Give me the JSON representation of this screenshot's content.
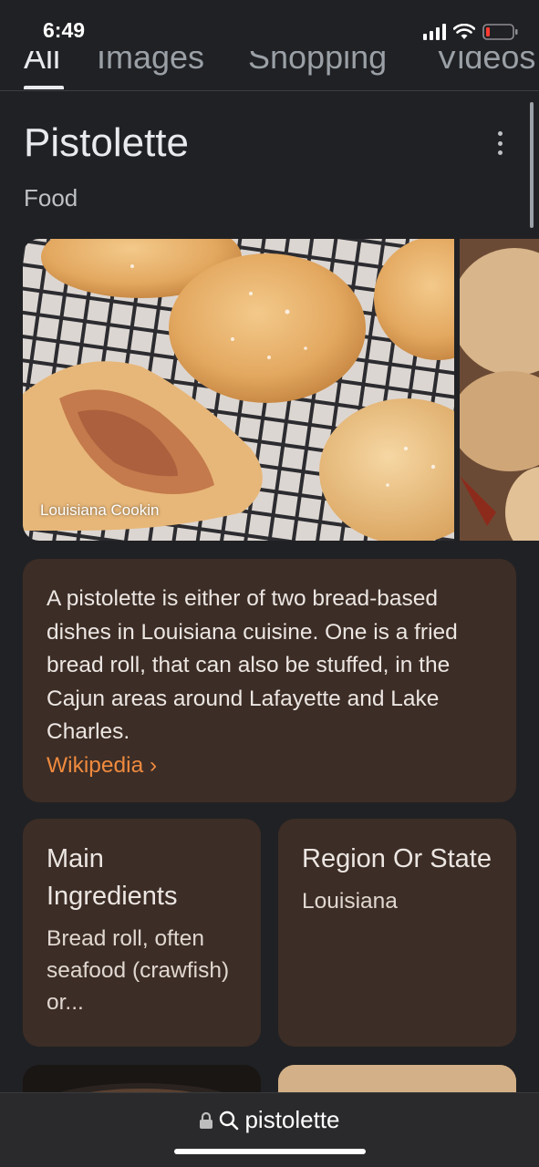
{
  "status_bar": {
    "time": "6:49"
  },
  "tabs": [
    {
      "label": "All",
      "active": true
    },
    {
      "label": "Images",
      "active": false
    },
    {
      "label": "Shopping",
      "active": false
    },
    {
      "label": "Videos",
      "active": false
    }
  ],
  "header": {
    "title": "Pistolette",
    "subtitle": "Food"
  },
  "gallery": {
    "caption": "Louisiana Cookin"
  },
  "description": {
    "text": "A pistolette is either of two bread-based dishes in Louisiana cuisine. One is a fried bread roll, that can also be stuffed, in the Cajun areas around Lafayette and Lake Charles.",
    "source_label": "Wikipedia ›"
  },
  "facts": [
    {
      "title": "Main Ingredients",
      "value": "Bread roll, often seafood (crawfish) or..."
    },
    {
      "title": "Region Or State",
      "value": "Louisiana"
    }
  ],
  "address_bar": {
    "query": "pistolette"
  },
  "colors": {
    "background": "#202124",
    "card": "#3c2d26",
    "link": "#ef8a3e"
  },
  "icons": [
    "signal-icon",
    "wifi-icon",
    "battery-icon",
    "more-vert-icon",
    "lock-icon",
    "search-icon"
  ]
}
